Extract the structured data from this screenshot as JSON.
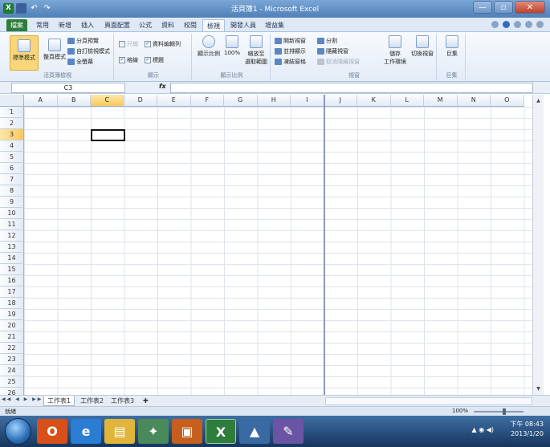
{
  "window": {
    "title": "活頁簿1 - Microsoft Excel",
    "minimize": "—",
    "maximize": "▫",
    "close": "✕"
  },
  "ribbon_tabs": [
    {
      "label": "檔案"
    },
    {
      "label": "常用"
    },
    {
      "label": "新增"
    },
    {
      "label": "插入"
    },
    {
      "label": "頁面配置"
    },
    {
      "label": "公式"
    },
    {
      "label": "資料"
    },
    {
      "label": "校閱"
    },
    {
      "label": "檢視"
    },
    {
      "label": "開發人員"
    },
    {
      "label": "增益集"
    }
  ],
  "ribbon": {
    "views": {
      "group_label": "活頁簿檢視",
      "normal": "標準模式",
      "page_layout": "整頁模式",
      "page_break": "分頁預覽",
      "custom_views": "自訂檢視模式",
      "full_screen": "全螢幕"
    },
    "show": {
      "group_label": "顯示",
      "ruler": "尺規",
      "formula_bar": "資料編輯列",
      "gridlines": "格線",
      "headings": "標題"
    },
    "zoom": {
      "group_label": "顯示比例",
      "zoom": "顯示比例",
      "hundred": "100%",
      "zoom_selection_1": "縮放至",
      "zoom_selection_2": "選取範圍"
    },
    "window": {
      "group_label": "視窗",
      "new_window": "開新視窗",
      "arrange_all": "並排顯示",
      "freeze_panes": "凍結窗格",
      "split": "分割",
      "hide": "隱藏視窗",
      "unhide": "取消隱藏視窗",
      "save_workspace_1": "儲存",
      "save_workspace_2": "工作環境",
      "switch_windows": "切換視窗"
    },
    "macros": {
      "group_label": "巨集",
      "macros": "巨集"
    }
  },
  "formula_bar": {
    "name_box": "C3",
    "fx": "fx",
    "content": ""
  },
  "columns": [
    "A",
    "B",
    "C",
    "D",
    "E",
    "F",
    "G",
    "H",
    "I",
    "J",
    "K",
    "L",
    "M",
    "N",
    "O"
  ],
  "rows": [
    "1",
    "2",
    "3",
    "4",
    "5",
    "6",
    "7",
    "8",
    "9",
    "10",
    "11",
    "12",
    "13",
    "14",
    "15",
    "16",
    "17",
    "18",
    "19",
    "20",
    "21",
    "22",
    "23",
    "24",
    "25",
    "26"
  ],
  "active_cell": "C3",
  "sheet_tabs": [
    {
      "label": "工作表1"
    },
    {
      "label": "工作表2"
    },
    {
      "label": "工作表3"
    }
  ],
  "status": {
    "ready": "就緒",
    "zoom": "100%"
  },
  "taskbar": {
    "time": "下午 08:43",
    "date": "2013/1/20"
  },
  "colors": {
    "excel_green": "#2f7d3b",
    "titlebar": "#4f7fb8",
    "active_header": "#f8c95e"
  }
}
